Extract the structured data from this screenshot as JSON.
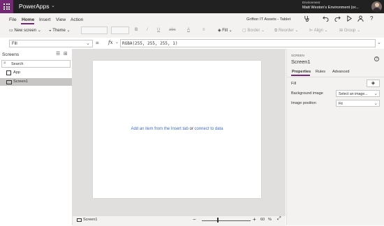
{
  "titlebar": {
    "app_name": "PowerApps",
    "app_chevron": "chevron-down-icon",
    "environment_label": "Environment",
    "environment_name": "Matt Weston's Environment (or...",
    "brand_color": "#742774",
    "bar_color": "#212121"
  },
  "menubar": {
    "items": [
      "File",
      "Home",
      "Insert",
      "View",
      "Action"
    ],
    "active": "Home",
    "document_title": "Grifton IT Assets - Tablet",
    "tools": [
      "stethoscope-icon",
      "undo-icon",
      "redo-icon",
      "play-icon",
      "user-icon",
      "help-icon"
    ],
    "help_glyph": "?"
  },
  "ribbon": {
    "new_screen": "New screen",
    "theme": "Theme",
    "bold": "B",
    "italic": "/",
    "underline": "U",
    "strikethrough": "abc",
    "font_color": "A",
    "align": "≡",
    "fill": "Fill",
    "border": "Border",
    "reorder": "Reorder",
    "align_menu": "Align",
    "group": "Group"
  },
  "formula_bar": {
    "property": "Fill",
    "equals": "=",
    "fx": "fx",
    "formula": "RGBA(255, 255, 255, 1)"
  },
  "left_pane": {
    "title": "Screens",
    "search_placeholder": "Search",
    "tree": [
      {
        "label": "App"
      },
      {
        "label": "Screen1",
        "selected": true
      }
    ]
  },
  "canvas": {
    "hint_prefix": "Add an item from the Insert tab ",
    "hint_or": "or",
    "hint_link": " connect to data",
    "background": "#ffffff"
  },
  "status": {
    "screen": "Screen1",
    "zoom_minus": "−",
    "zoom_plus": "+",
    "zoom_value": "60",
    "zoom_unit": "%",
    "zoom_fraction": 0.33
  },
  "right_pane": {
    "kind": "SCREEN",
    "name": "Screen1",
    "help": "?",
    "tabs": [
      "Properties",
      "Rules",
      "Advanced"
    ],
    "active_tab": "Properties",
    "fill_label": "Fill",
    "background_image_label": "Background image",
    "background_image_value": "Select an image...",
    "image_position_label": "Image position",
    "image_position_value": "Fit"
  }
}
